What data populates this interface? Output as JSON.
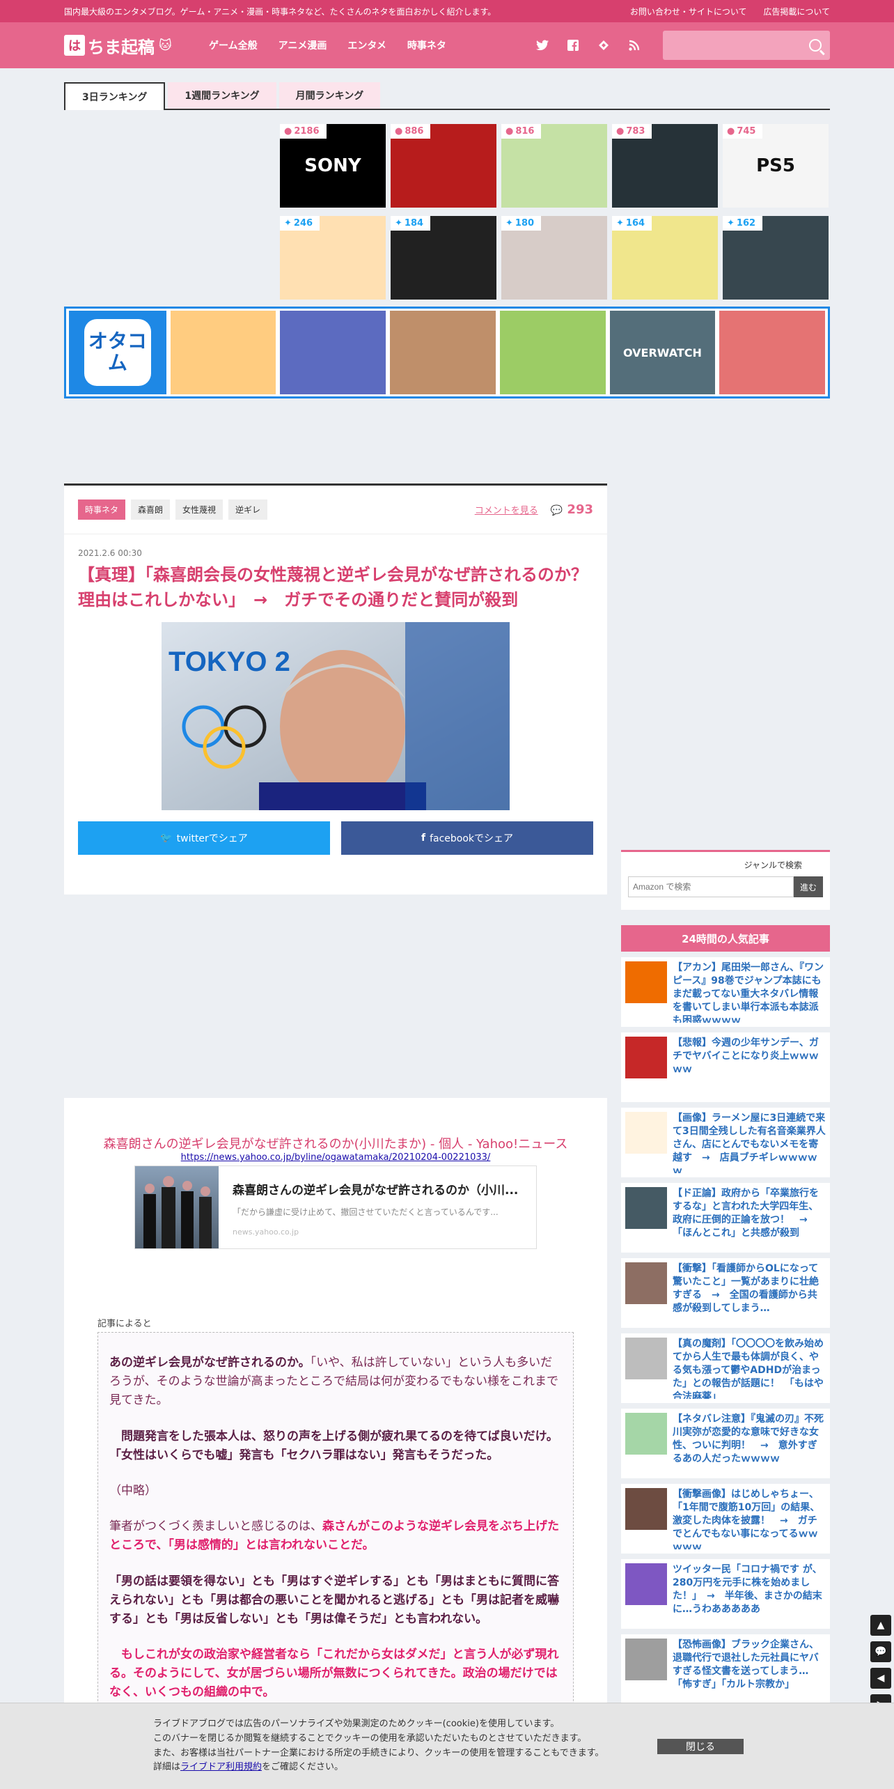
{
  "topbar": {
    "tagline": "国内最大級のエンタメブログ。ゲーム・アニメ・漫画・時事ネタなど、たくさんのネタを面白おかしく紹介します。",
    "contact": "お問い合わせ・サイトについて",
    "ads": "広告掲載について"
  },
  "header": {
    "logo_mark": "は",
    "logo_text": "ちま起稿",
    "nav": [
      "ゲーム全般",
      "アニメ漫画",
      "エンタメ",
      "時事ネタ"
    ],
    "search_placeholder": ""
  },
  "tabs": [
    "3日ランキング",
    "1週間ランキング",
    "月間ランキング"
  ],
  "ranking": {
    "comments": [
      {
        "count": "2186",
        "label": "SONY",
        "bg": "#000000",
        "fg": "#ffffff"
      },
      {
        "count": "886",
        "label": "",
        "bg": "#b71c1c",
        "fg": "#ffffff"
      },
      {
        "count": "816",
        "label": "",
        "bg": "#c5e1a5",
        "fg": "#2e7d32"
      },
      {
        "count": "783",
        "label": "",
        "bg": "#263238",
        "fg": "#ffffff"
      },
      {
        "count": "745",
        "label": "PS5",
        "bg": "#f5f5f5",
        "fg": "#111111"
      }
    ],
    "tweets": [
      {
        "count": "246",
        "label": "",
        "bg": "#ffe0b2",
        "fg": "#d84315"
      },
      {
        "count": "184",
        "label": "",
        "bg": "#212121",
        "fg": "#9e9e9e"
      },
      {
        "count": "180",
        "label": "",
        "bg": "#d7ccc8",
        "fg": "#4e342e"
      },
      {
        "count": "164",
        "label": "",
        "bg": "#f0e68c",
        "fg": "#6a1b9a"
      },
      {
        "count": "162",
        "label": "",
        "bg": "#37474f",
        "fg": "#ffffff"
      }
    ]
  },
  "otacom": {
    "logo": "オタコム",
    "thumbs": [
      {
        "label": "",
        "bg": "#ffcc80"
      },
      {
        "label": "",
        "bg": "#5c6bc0"
      },
      {
        "label": "",
        "bg": "#bf8f6a"
      },
      {
        "label": "",
        "bg": "#9ccc65"
      },
      {
        "label": "OVERWATCH",
        "bg": "#546e7a"
      },
      {
        "label": "",
        "bg": "#e57373"
      }
    ]
  },
  "article": {
    "tags": [
      "時事ネタ",
      "森喜朗",
      "女性蔑視",
      "逆ギレ"
    ],
    "comments_link": "コメントを見る",
    "comment_count": "293",
    "date": "2021.2.6 00:30",
    "title": "【真理】「森喜朗会長の女性蔑視と逆ギレ会見がなぜ許されるのか？理由はこれしかない」　→　ガチでその通りだと賛同が殺到",
    "hero_text": "TOKYO 2",
    "share_twitter": "twitterでシェア",
    "share_facebook": "facebookでシェア"
  },
  "sidebar": {
    "search_label": "ジャンルで検索",
    "search_placeholder": "Amazon で検索",
    "search_button": "進む",
    "popular_head": "24時間の人気記事",
    "popular": [
      {
        "title": "【アカン】尾田栄一郎さん、『ワンピース』98巻でジャンプ本誌にもまだ載ってない重大ネタバレ情報を書いてしまい単行本派も本誌派も困惑ｗｗｗｗ",
        "color": "#ef6c00"
      },
      {
        "title": "【悲報】今週の少年サンデー、ガチでヤバイことになり炎上ｗｗｗｗｗ",
        "color": "#c62828"
      },
      {
        "title": "【画像】ラーメン屋に3日連続で来て3日間全残しした有名音楽業界人さん、店にとんでもないメモを寄越す　→　店員ブチギレｗｗｗｗｗ",
        "color": "#fff3e0"
      },
      {
        "title": "【ド正論】政府から「卒業旅行をするな」と言われた大学四年生、政府に圧倒的正論を放つ！　→　「ほんとこれ」と共感が殺到",
        "color": "#455a64"
      },
      {
        "title": "【衝撃】「看護師からOLになって驚いたこと」一覧があまりに壮絶すぎる　→　全国の看護師から共感が殺到してしまう…",
        "color": "#8d6e63"
      },
      {
        "title": "【真の魔剤】「〇〇〇〇を飲み始めてから人生で最も体調が良く、やる気も漲って鬱やADHDが治まった」との報告が話題に！　「もはや合法麻薬」",
        "color": "#bdbdbd"
      },
      {
        "title": "【ネタバレ注意】『鬼滅の刃』不死川実弥が恋愛的な意味で好きな女性、ついに判明！　→　意外すぎるあの人だったｗｗｗｗ",
        "color": "#a5d6a7"
      },
      {
        "title": "【衝撃画像】はじめしゃちょー、「1年間で腹筋10万回」の結果、激変した肉体を披露！　→　ガチでとんでもない事になってるｗｗｗｗｗ",
        "color": "#6d4c41"
      },
      {
        "title": "ツイッター民「コロナ禍です が、280万円を元手に株を始めました！」　→　半年後、まさかの結末に…うわあああああ",
        "color": "#7e57c2"
      },
      {
        "title": "【恐怖画像】ブラック企業さん、退職代行で退社した元社員にヤバすぎる怪文書を送ってしまう…　「怖すぎ」「カルト宗教か」",
        "color": "#9e9e9e"
      }
    ]
  },
  "body": {
    "source_title": "森喜朗さんの逆ギレ会見がなぜ許されるのか(小川たまか) - 個人 - Yahoo!ニュース",
    "source_url": "https://news.yahoo.co.jp/byline/ogawatamaka/20210204-00221033/",
    "card_title": "森喜朗さんの逆ギレ会見がなぜ許されるのか（小川...",
    "card_desc": "「だから謙虚に受け止めて、撤回させていただくと言っているんです...",
    "card_site": "news.yahoo.co.jp",
    "according": "記事によると",
    "p1_bold": "あの逆ギレ会見がなぜ許されるのか。",
    "p1_rest": "「いや、私は許していない」という人も多いだろうが、そのような世論が高まったところで結局は何が変わるでもない様をこれまで見てきた。",
    "p2": "　問題発言をした張本人は、怒りの声を上げる側が疲れ果てるのを待てば良いだけ。「女性はいくらでも嘘」発言も「セクハラ罪はない」発言もそうだった。",
    "p3": "（中略）",
    "p4_start": "筆者がつくづく羨ましいと感じるのは、",
    "p4_red": "森さんがこのような逆ギレ会見をぶち上げたところで、「男は感情的」とは言われないことだ。",
    "p5": "「男の話は要領を得ない」とも「男はすぐ逆ギレする」とも「男はまともに質問に答えられない」とも「男は都合の悪いことを聞かれると逃げる」とも「男は記者を威嚇する」とも「男は反省しない」とも「男は偉そうだ」とも言われない。",
    "p6": "　もしこれが女の政治家や経営者なら「これだから女はダメだ」と言う人が必ず現れる。そのようにして、女が居づらい場所が無数につくられてきた。政治の場だけではなく、いくつもの組織の中で。"
  },
  "cookie": {
    "line1": "ライブドアブログでは広告のパーソナライズや効果測定のためクッキー(cookie)を使用しています。",
    "line2": "このバナーを閉じるか閲覧を継続することでクッキーの使用を承認いただいたものとさせていただきます。",
    "line3": "また、お客様は当社パートナー企業における所定の手続きにより、クッキーの使用を管理することもできます。",
    "line4_pre": "詳細は",
    "line4_link": "ライブドア利用規約",
    "line4_post": "をご確認ください。",
    "close": "閉じる"
  }
}
